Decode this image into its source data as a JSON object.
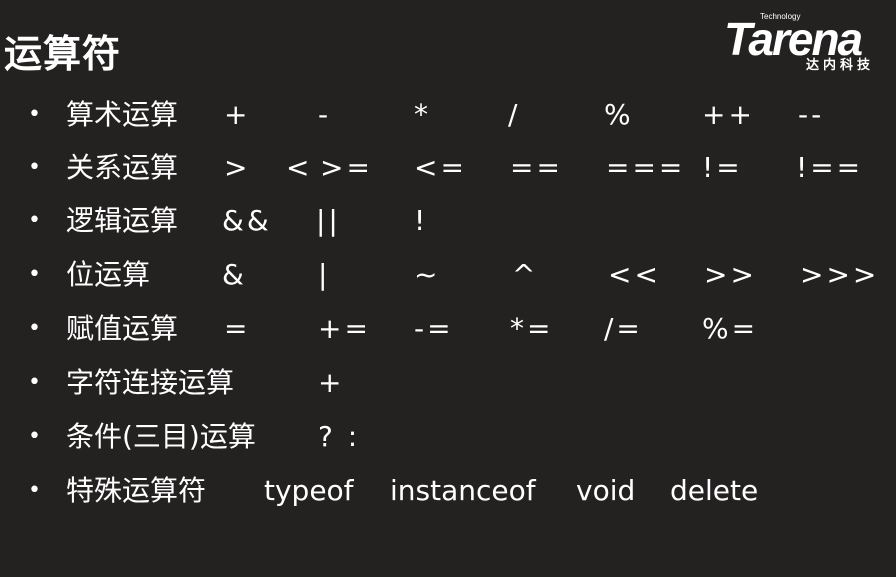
{
  "slide": {
    "title": "运算符",
    "logo": {
      "brand": "Tarena",
      "tagline": "Technology",
      "chinese": "达内科技"
    },
    "bullet_glyph": "•",
    "rows": [
      {
        "label": "算术运算",
        "operators": [
          "+",
          "-",
          "*",
          "/",
          "%",
          "++",
          "--"
        ]
      },
      {
        "label": "关系运算",
        "operators": [
          ">",
          "<",
          ">=",
          "<=",
          "==",
          "===",
          "!=",
          "!=="
        ]
      },
      {
        "label": "逻辑运算",
        "operators": [
          "&&",
          "||",
          "!"
        ]
      },
      {
        "label": "位运算",
        "operators": [
          "&",
          "|",
          "~",
          "^",
          "<<",
          ">>",
          ">>>"
        ]
      },
      {
        "label": "赋值运算",
        "operators": [
          "=",
          "+=",
          "-=",
          "*=",
          "/=",
          "%="
        ]
      },
      {
        "label": "字符连接运算",
        "operators": [
          "+"
        ]
      },
      {
        "label": "条件(三目)运算",
        "operators": [
          "? :"
        ]
      },
      {
        "label": "特殊运算符",
        "operators": [
          "typeof",
          "instanceof",
          "void",
          "delete"
        ]
      }
    ]
  }
}
